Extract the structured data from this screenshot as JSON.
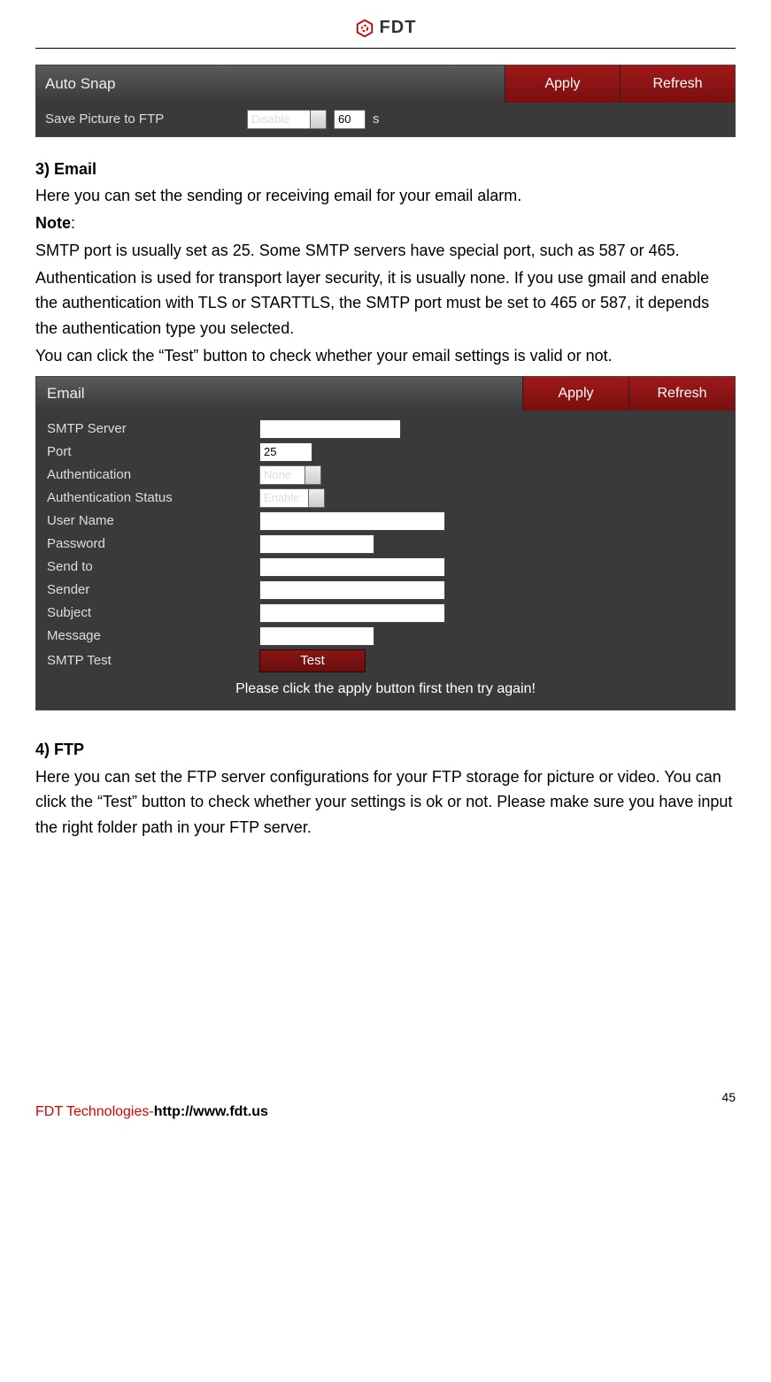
{
  "header": {
    "brand": "FDT"
  },
  "autosnap": {
    "title": "Auto Snap",
    "apply": "Apply",
    "refresh": "Refresh",
    "row_label": "Save Picture to FTP",
    "select_value": "Disable",
    "num_value": "60",
    "unit": "s"
  },
  "section3": {
    "heading": "3) Email",
    "p1": "Here you can set the sending or receiving email for your email alarm.",
    "note_label": "Note",
    "note_colon": ":",
    "p2": "SMTP port is usually set as 25. Some SMTP servers have special port, such as 587 or 465.",
    "p3": "Authentication is used for transport layer security, it is usually none. If you use gmail and enable the authentication with TLS or STARTTLS, the SMTP port must be set to 465 or 587, it depends the authentication type you selected.",
    "p4": "You can click the “Test” button to check whether your email settings is valid or not."
  },
  "email": {
    "title": "Email",
    "apply": "Apply",
    "refresh": "Refresh",
    "fields": {
      "smtp_server": "SMTP Server",
      "port": "Port",
      "port_value": "25",
      "auth": "Authentication",
      "auth_value": "None",
      "auth_status": "Authentication Status",
      "auth_status_value": "Enable",
      "user": "User Name",
      "password": "Password",
      "sendto": "Send to",
      "sender": "Sender",
      "subject": "Subject",
      "message": "Message",
      "smtp_test": "SMTP Test",
      "test_btn": "Test"
    },
    "hint": "Please click the apply button first then try again!"
  },
  "section4": {
    "heading": "4) FTP",
    "p1": "Here you can set the FTP server configurations for your FTP storage for picture or video. You can click the “Test” button to check whether your settings is ok or not. Please make sure you have input the right folder path in your FTP server."
  },
  "footer": {
    "page": "45",
    "company": "FDT Technologies-",
    "url": "http://www.fdt.us"
  }
}
